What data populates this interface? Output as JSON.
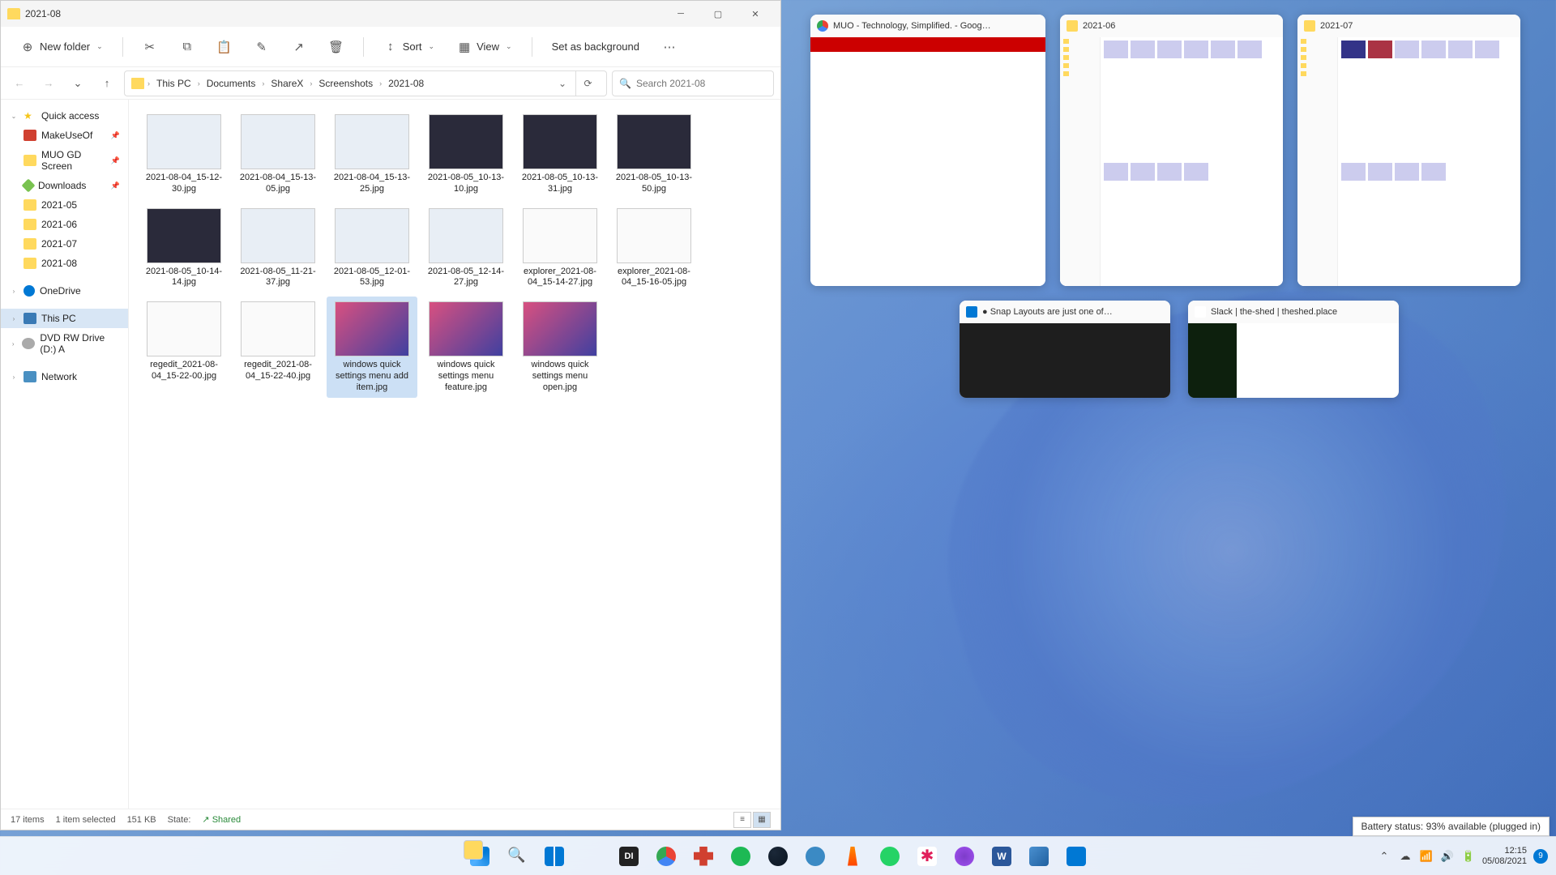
{
  "window": {
    "title": "2021-08",
    "toolbar": {
      "new_folder": "New folder",
      "sort": "Sort",
      "view": "View",
      "set_background": "Set as background"
    },
    "breadcrumb": [
      "This PC",
      "Documents",
      "ShareX",
      "Screenshots",
      "2021-08"
    ],
    "search_placeholder": "Search 2021-08"
  },
  "sidebar": {
    "quick_access": "Quick access",
    "items": [
      {
        "label": "MakeUseOf",
        "icon": "red",
        "pinned": true
      },
      {
        "label": "MUO GD Screen",
        "icon": "folder",
        "pinned": true
      },
      {
        "label": "Downloads",
        "icon": "green",
        "pinned": true
      },
      {
        "label": "2021-05",
        "icon": "folder"
      },
      {
        "label": "2021-06",
        "icon": "folder"
      },
      {
        "label": "2021-07",
        "icon": "folder"
      },
      {
        "label": "2021-08",
        "icon": "folder"
      }
    ],
    "onedrive": "OneDrive",
    "thispc": "This PC",
    "dvd": "DVD RW Drive (D:) A",
    "network": "Network"
  },
  "files": [
    {
      "name": "2021-08-04_15-12-30.jpg",
      "thumb": "light"
    },
    {
      "name": "2021-08-04_15-13-05.jpg",
      "thumb": "light"
    },
    {
      "name": "2021-08-04_15-13-25.jpg",
      "thumb": "light"
    },
    {
      "name": "2021-08-05_10-13-10.jpg",
      "thumb": "dark"
    },
    {
      "name": "2021-08-05_10-13-31.jpg",
      "thumb": "dark"
    },
    {
      "name": "2021-08-05_10-13-50.jpg",
      "thumb": "dark"
    },
    {
      "name": "2021-08-05_10-14-14.jpg",
      "thumb": "dark"
    },
    {
      "name": "2021-08-05_11-21-37.jpg",
      "thumb": "light"
    },
    {
      "name": "2021-08-05_12-01-53.jpg",
      "thumb": "light"
    },
    {
      "name": "2021-08-05_12-14-27.jpg",
      "thumb": "light"
    },
    {
      "name": "explorer_2021-08-04_15-14-27.jpg",
      "thumb": "white"
    },
    {
      "name": "explorer_2021-08-04_15-16-05.jpg",
      "thumb": "white"
    },
    {
      "name": "regedit_2021-08-04_15-22-00.jpg",
      "thumb": "white"
    },
    {
      "name": "regedit_2021-08-04_15-22-40.jpg",
      "thumb": "white"
    },
    {
      "name": "windows quick settings menu add item.jpg",
      "thumb": "pink",
      "selected": true
    },
    {
      "name": "windows quick settings menu feature.jpg",
      "thumb": "pink"
    },
    {
      "name": "windows quick settings menu open.jpg",
      "thumb": "pink"
    }
  ],
  "status": {
    "count": "17 items",
    "selected": "1 item selected",
    "size": "151 KB",
    "state_label": "State:",
    "state_value": "Shared"
  },
  "snap": {
    "cards": [
      {
        "title": "MUO - Technology, Simplified. - Goog…",
        "icon": "chrome",
        "body": "website"
      },
      {
        "title": "2021-06",
        "icon": "folder",
        "body": "explorer"
      },
      {
        "title": "2021-07",
        "icon": "folder",
        "body": "explorer"
      },
      {
        "title": "● Snap Layouts are just one of…",
        "icon": "vscode",
        "body": "dark"
      },
      {
        "title": "Slack | the-shed | theshed.place",
        "icon": "slack",
        "body": "slack"
      }
    ]
  },
  "battery_tooltip": "Battery status: 93% available (plugged in)",
  "systray": {
    "time": "12:15",
    "date": "05/08/2021",
    "notifications": "9"
  }
}
